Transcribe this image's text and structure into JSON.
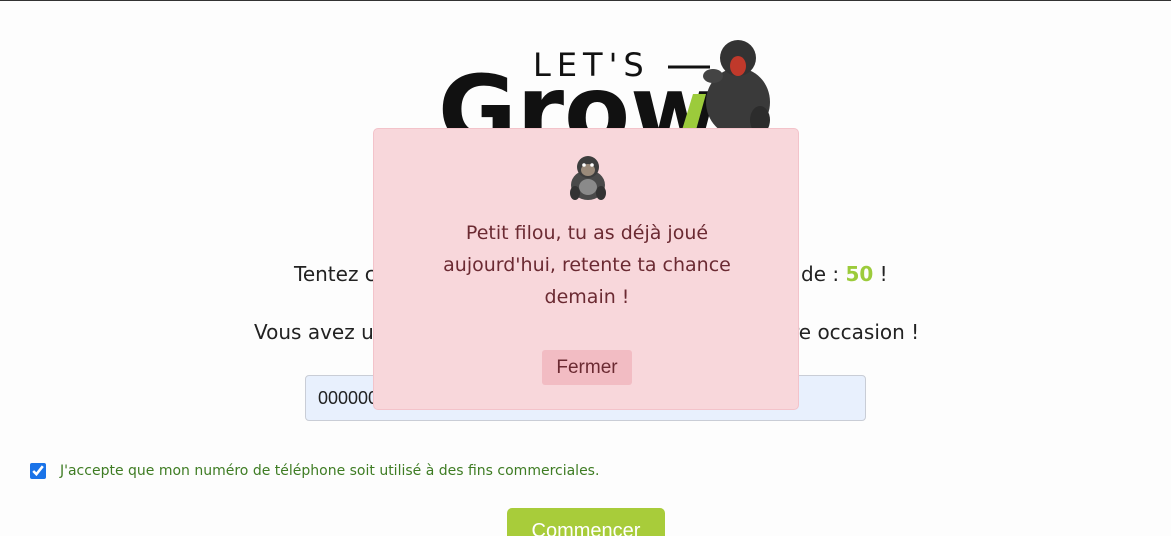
{
  "logo": {
    "word_top": "LET'S",
    "word_main": "Grow"
  },
  "main": {
    "line1_left": "Tentez c",
    "line1_right_prefix": "de : ",
    "points": "50",
    "line1_right_suffix": " !",
    "line2_left": "Vous avez u",
    "line2_right": "re occasion !",
    "phone_value": "000000",
    "consent_label": "J'accepte que mon numéro de téléphone soit utilisé à des fins commerciales.",
    "consent_checked": true,
    "start_label": "Commencer"
  },
  "modal": {
    "icon": "gorilla-icon",
    "message": "Petit filou, tu as déjà joué aujourd'hui, retente ta chance demain !",
    "close_label": "Fermer"
  },
  "colors": {
    "accent_green": "#a8cc3a",
    "modal_bg": "#f8d7db",
    "modal_text": "#6b2a32",
    "consent_text": "#3e7c23"
  }
}
